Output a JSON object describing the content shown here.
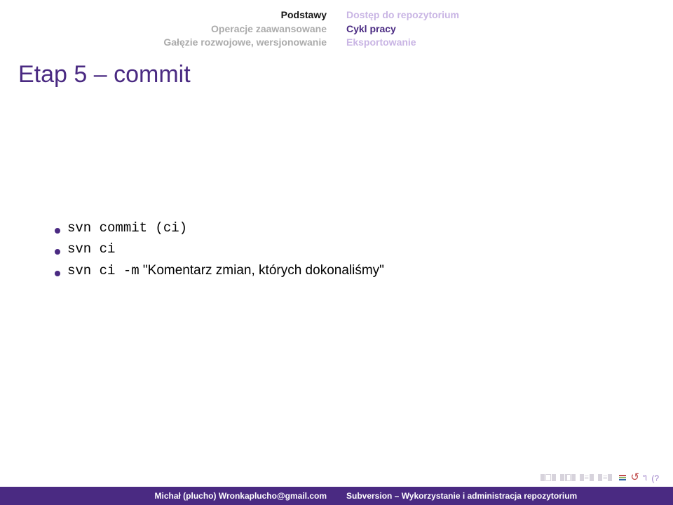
{
  "nav": {
    "left": {
      "items": [
        {
          "label": "Podstawy",
          "active": true
        },
        {
          "label": "Operacje zaawansowane",
          "active": false
        },
        {
          "label": "Gałęzie rozwojowe, wersjonowanie",
          "active": false
        }
      ]
    },
    "right": {
      "items": [
        {
          "label": "Dostęp do repozytorium",
          "active": false
        },
        {
          "label": "Cykl pracy",
          "active": true
        },
        {
          "label": "Eksportowanie",
          "active": false
        }
      ]
    }
  },
  "title": "Etap 5 – commit",
  "bullets": [
    {
      "code": "svn commit (ci)",
      "rest": ""
    },
    {
      "code": "svn ci",
      "rest": ""
    },
    {
      "code": "svn ci -m",
      "rest": " \"Komentarz zmian, których dokonaliśmy\""
    }
  ],
  "colors": {
    "bullet": "#4a2a82",
    "bar1": "#c04a4a",
    "bar2": "#8fb86b",
    "bar3": "#3264a8"
  },
  "footer": {
    "left": "Michał (plucho) Wronkaplucho@gmail.com",
    "right": "Subversion – Wykorzystanie i administracja repozytorium"
  }
}
